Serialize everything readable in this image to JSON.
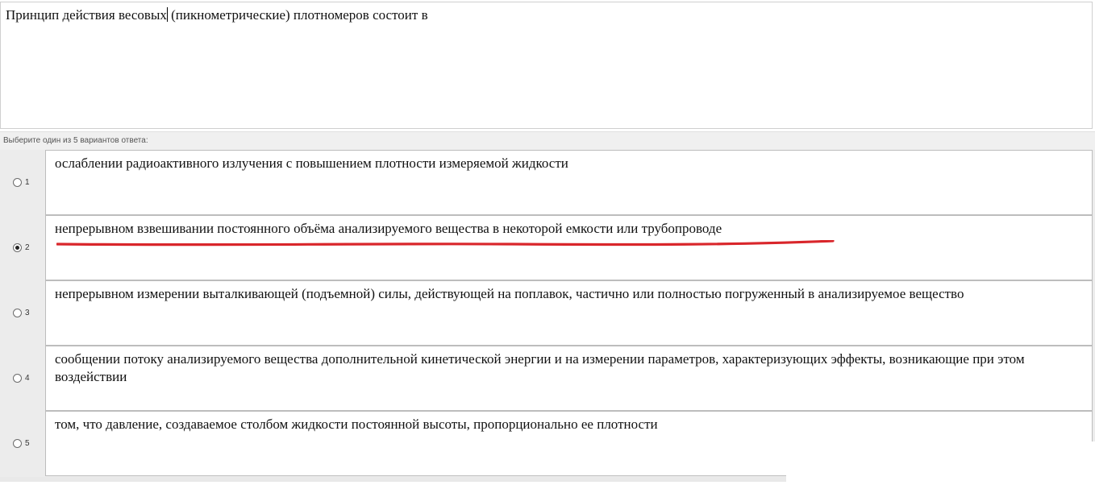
{
  "question": {
    "text_before_caret": "Принцип действия весовых",
    "text_after_caret": " (пикнометрические) плотномеров состоит в"
  },
  "hint": "Выберите один из 5 вариантов ответа:",
  "answers": [
    {
      "number": "1",
      "text": "ослаблении радиоактивного излучения с повышением плотности измеряемой жидкости",
      "selected": false
    },
    {
      "number": "2",
      "text": "непрерывном взвешивании постоянного объёма анализируемого вещества в некоторой емкости или трубопроводе",
      "selected": true
    },
    {
      "number": "3",
      "text": "непрерывном измерении выталкивающей (подъемной) силы, действующей на поплавок, частично или полностью погруженный в анализируемое вещество",
      "selected": false
    },
    {
      "number": "4",
      "text": "сообщении потоку анализируемого вещества дополнительной кинетической энергии и на измерении параметров, характеризующих эффекты, возникающие при этом воздействии",
      "selected": false
    },
    {
      "number": "5",
      "text": "том, что давление, создаваемое столбом жидкости постоянной высоты, пропорционально ее плотности",
      "selected": false
    }
  ],
  "colors": {
    "annotation_underline": "#d9262b"
  }
}
